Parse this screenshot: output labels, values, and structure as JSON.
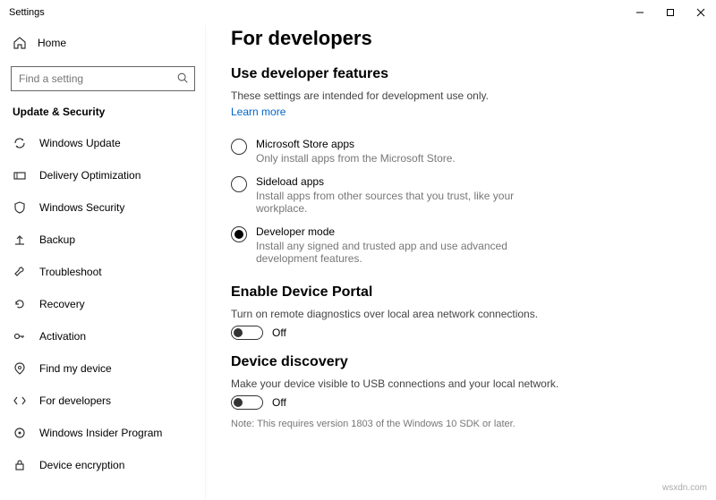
{
  "window": {
    "title": "Settings"
  },
  "sidebar": {
    "home": "Home",
    "search_placeholder": "Find a setting",
    "category": "Update & Security",
    "items": [
      {
        "label": "Windows Update"
      },
      {
        "label": "Delivery Optimization"
      },
      {
        "label": "Windows Security"
      },
      {
        "label": "Backup"
      },
      {
        "label": "Troubleshoot"
      },
      {
        "label": "Recovery"
      },
      {
        "label": "Activation"
      },
      {
        "label": "Find my device"
      },
      {
        "label": "For developers"
      },
      {
        "label": "Windows Insider Program"
      },
      {
        "label": "Device encryption"
      }
    ]
  },
  "content": {
    "title": "For developers",
    "dev_features_heading": "Use developer features",
    "dev_features_intro": "These settings are intended for development use only.",
    "learn_more": "Learn more",
    "options": [
      {
        "label": "Microsoft Store apps",
        "desc": "Only install apps from the Microsoft Store.",
        "checked": false
      },
      {
        "label": "Sideload apps",
        "desc": "Install apps from other sources that you trust, like your workplace.",
        "checked": false
      },
      {
        "label": "Developer mode",
        "desc": "Install any signed and trusted app and use advanced development features.",
        "checked": true
      }
    ],
    "device_portal_heading": "Enable Device Portal",
    "device_portal_desc": "Turn on remote diagnostics over local area network connections.",
    "device_portal_toggle": "Off",
    "device_discovery_heading": "Device discovery",
    "device_discovery_desc": "Make your device visible to USB connections and your local network.",
    "device_discovery_toggle": "Off",
    "device_discovery_note": "Note: This requires version 1803 of the Windows 10 SDK or later."
  },
  "watermark": "wsxdn.com"
}
